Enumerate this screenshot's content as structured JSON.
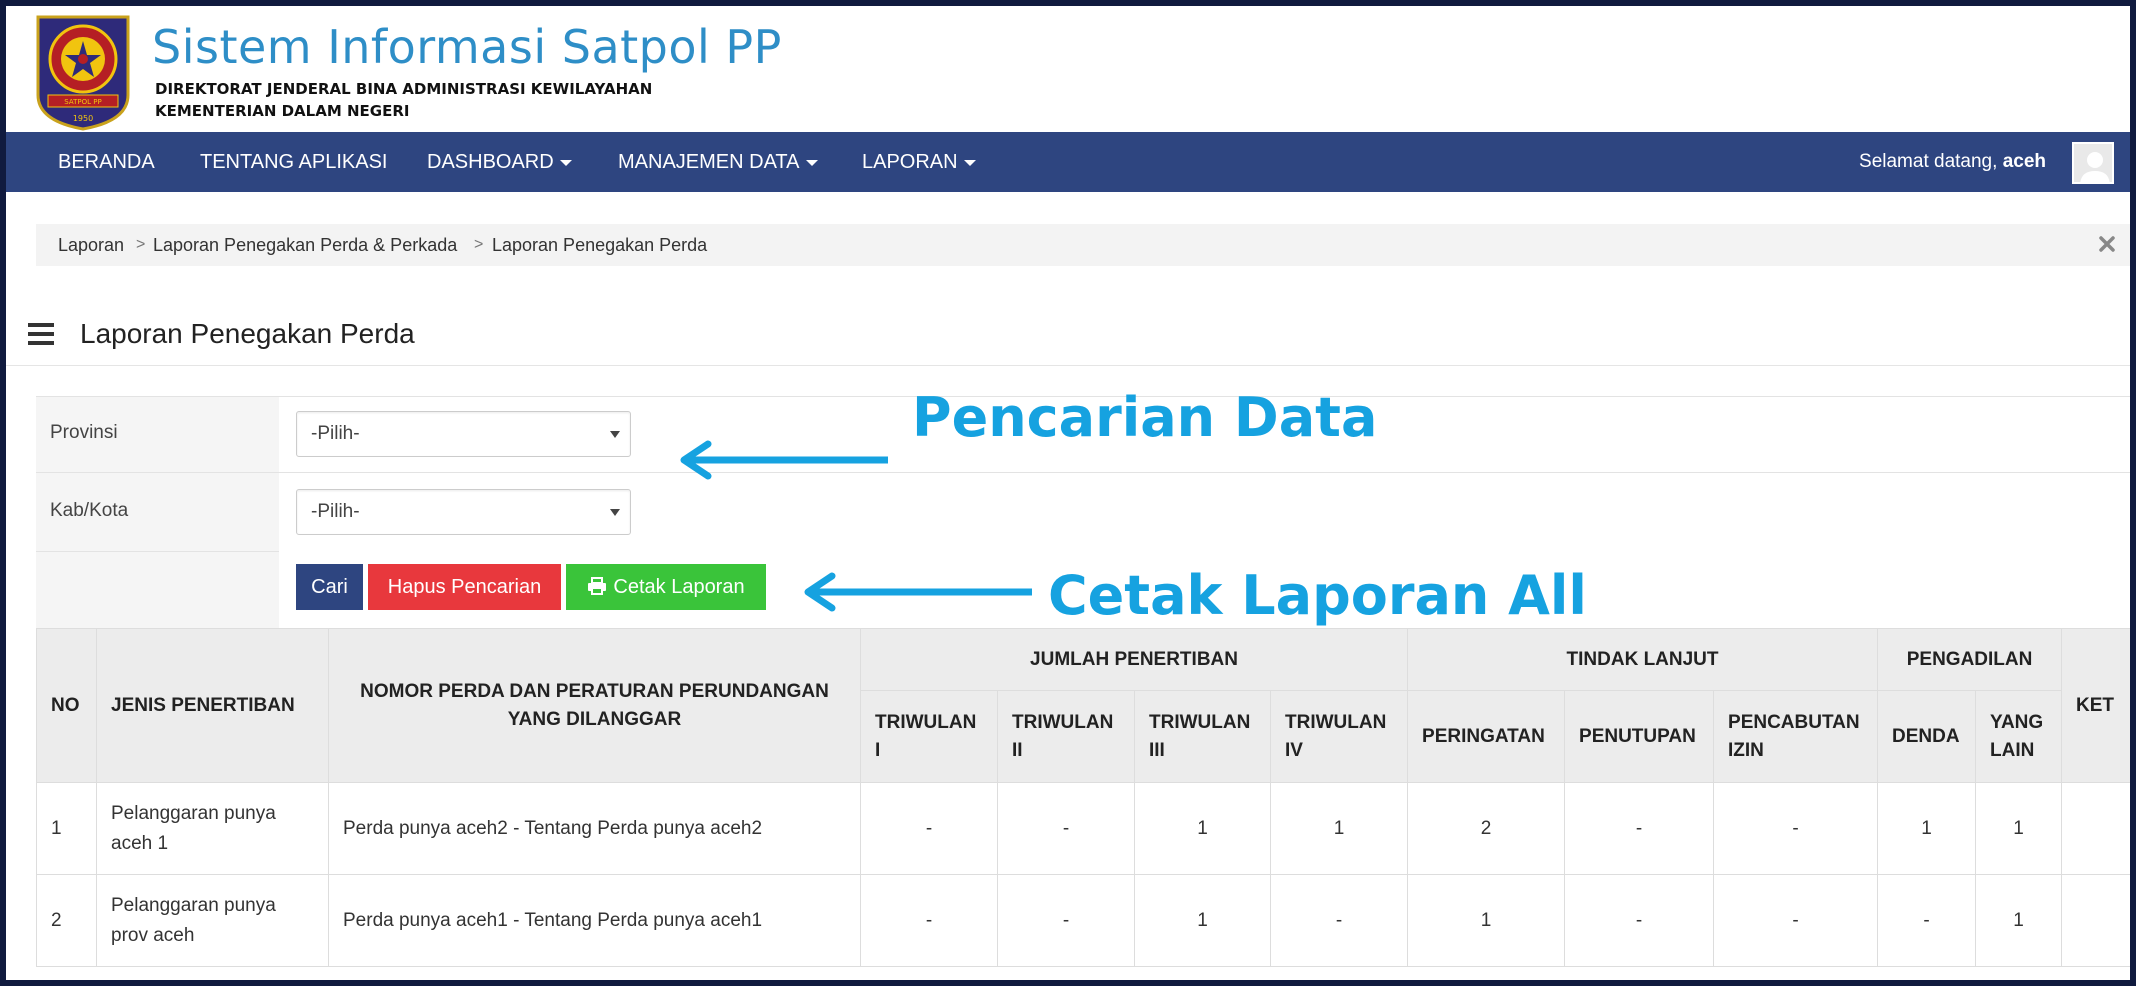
{
  "header": {
    "title": "Sistem Informasi Satpol PP",
    "subtitle_line1": "DIREKTORAT JENDERAL BINA ADMINISTRASI KEWILAYAHAN",
    "subtitle_line2": "KEMENTERIAN DALAM NEGERI",
    "logo_ribbon_text": "SATPOL PP",
    "logo_year": "1950"
  },
  "navbar": {
    "items": [
      {
        "label": "BERANDA",
        "dropdown": false
      },
      {
        "label": "TENTANG APLIKASI",
        "dropdown": false
      },
      {
        "label": "DASHBOARD",
        "dropdown": true
      },
      {
        "label": "MANAJEMEN DATA",
        "dropdown": true
      },
      {
        "label": "LAPORAN",
        "dropdown": true
      }
    ],
    "welcome_text": "Selamat datang,",
    "username": "aceh"
  },
  "breadcrumb": {
    "items": [
      "Laporan",
      "Laporan Penegakan Perda & Perkada",
      "Laporan Penegakan Perda"
    ],
    "separator": ">"
  },
  "page": {
    "title": "Laporan Penegakan Perda"
  },
  "filters": {
    "provinsi_label": "Provinsi",
    "provinsi_value": "-Pilih-",
    "kabkota_label": "Kab/Kota",
    "kabkota_value": "-Pilih-"
  },
  "buttons": {
    "cari": "Cari",
    "hapus": "Hapus Pencarian",
    "cetak": "Cetak Laporan"
  },
  "annotations": {
    "search": "Pencarian Data",
    "print": "Cetak Laporan All",
    "color": "#16a2e0"
  },
  "table": {
    "headers": {
      "no": "NO",
      "jenis": "JENIS PENERTIBAN",
      "nomor_perda": "NOMOR PERDA DAN PERATURAN PERUNDANGAN YANG DILANGGAR",
      "jumlah": "JUMLAH PENERTIBAN",
      "triwulan": [
        "TRIWULAN I",
        "TRIWULAN II",
        "TRIWULAN III",
        "TRIWULAN IV"
      ],
      "tindak_lanjut": "TINDAK LANJUT",
      "tindak_sub": [
        "PERINGATAN",
        "PENUTUPAN",
        "PENCABUTAN IZIN"
      ],
      "pengadilan": "PENGADILAN",
      "pengadilan_sub": [
        "DENDA",
        "YANG LAIN"
      ],
      "ket": "KET"
    },
    "rows": [
      {
        "no": "1",
        "jenis": "Pelanggaran punya aceh 1",
        "perda": "Perda punya aceh2 - Tentang Perda punya aceh2",
        "tw1": "-",
        "tw2": "-",
        "tw3": "1",
        "tw4": "1",
        "peringatan": "2",
        "penutupan": "-",
        "pencabutan": "-",
        "denda": "1",
        "yang_lain": "1",
        "ket": ""
      },
      {
        "no": "2",
        "jenis": "Pelanggaran punya prov aceh",
        "perda": "Perda punya aceh1 - Tentang Perda punya aceh1",
        "tw1": "-",
        "tw2": "-",
        "tw3": "1",
        "tw4": "-",
        "peringatan": "1",
        "penutupan": "-",
        "pencabutan": "-",
        "denda": "-",
        "yang_lain": "1",
        "ket": ""
      }
    ]
  },
  "colors": {
    "navbar": "#2e4580",
    "title_blue": "#2e8ec7",
    "btn_cari": "#2e4580",
    "btn_hapus": "#e8383d",
    "btn_cetak": "#3ac43a",
    "outer_frame": "#101a3e"
  }
}
